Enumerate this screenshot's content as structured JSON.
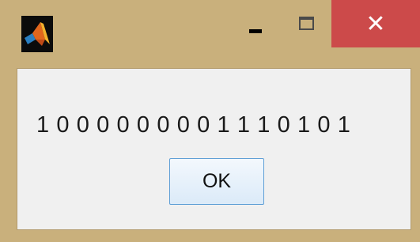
{
  "window": {
    "app_icon": "matlab-logo-icon",
    "controls": {
      "minimize_icon": "minimize-icon",
      "maximize_icon": "maximize-icon",
      "close_icon": "close-icon",
      "close_glyph": "✕"
    },
    "colors": {
      "frame": "#c9b07c",
      "close_button": "#cc4a4a",
      "client_area": "#f0f0f0",
      "ok_border": "#5f9fd6"
    }
  },
  "dialog": {
    "message": "1 0 0 0 0 0 0 0 0 1 1 1 0 1 0 1",
    "ok_label": "OK"
  }
}
